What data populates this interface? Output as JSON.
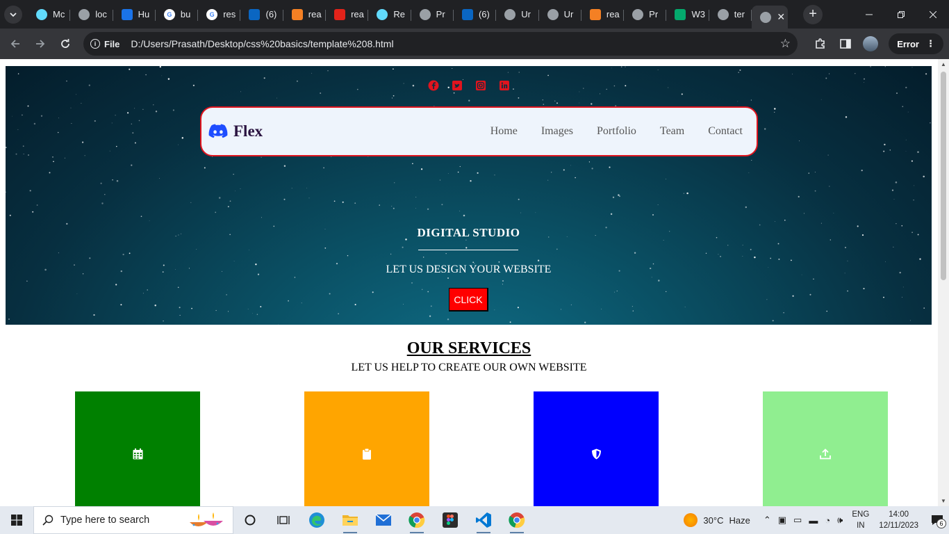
{
  "browser": {
    "tabs": [
      {
        "label": "Mc",
        "icon": "react-icon",
        "color": "#61dafb"
      },
      {
        "label": "loc",
        "icon": "react-icon",
        "color": "#9aa0a6"
      },
      {
        "label": "Hu",
        "icon": "h-logo-icon",
        "color": "#1a73e8"
      },
      {
        "label": "bu",
        "icon": "google-icon",
        "color": "#ffffff"
      },
      {
        "label": "res",
        "icon": "google-icon",
        "color": "#ffffff"
      },
      {
        "label": "(6)",
        "icon": "linkedin-icon",
        "color": "#0a66c2"
      },
      {
        "label": "rea",
        "icon": "stackoverflow-icon",
        "color": "#f48024"
      },
      {
        "label": "rea",
        "icon": "n-logo-icon",
        "color": "#e2231a"
      },
      {
        "label": "Re",
        "icon": "react-icon",
        "color": "#61dafb"
      },
      {
        "label": "Pr",
        "icon": "github-icon",
        "color": "#9aa0a6"
      },
      {
        "label": "(6)",
        "icon": "linkedin-icon",
        "color": "#0a66c2"
      },
      {
        "label": "Ur",
        "icon": "globe-icon",
        "color": "#9aa0a6"
      },
      {
        "label": "Ur",
        "icon": "globe-icon",
        "color": "#9aa0a6"
      },
      {
        "label": "rea",
        "icon": "stackoverflow-icon",
        "color": "#f48024"
      },
      {
        "label": "Pr",
        "icon": "github-icon",
        "color": "#9aa0a6"
      },
      {
        "label": "W3",
        "icon": "w3-icon",
        "color": "#04aa6d"
      },
      {
        "label": "ter",
        "icon": "globe-icon",
        "color": "#9aa0a6"
      }
    ],
    "url_chip": "File",
    "url": "D:/Users/Prasath/Desktop/css%20basics/template%208.html",
    "error_label": "Error"
  },
  "page": {
    "brand": "Flex",
    "nav": [
      "Home",
      "Images",
      "Portfolio",
      "Team",
      "Contact"
    ],
    "hero_title": "DIGITAL STUDIO",
    "hero_subtitle": "LET US DESIGN YOUR WEBSITE",
    "hero_button": "CLICK",
    "services_title": "OUR SERVICES",
    "services_subtitle": "LET US HELP TO CREATE OUR OWN WEBSITE",
    "cards": [
      {
        "icon": "calendar-icon",
        "color": "#008000"
      },
      {
        "icon": "clipboard-icon",
        "color": "#ffa500"
      },
      {
        "icon": "shield-icon",
        "color": "#0000ff"
      },
      {
        "icon": "upload-icon",
        "color": "#90ee90"
      }
    ],
    "accent_color": "#ff0000"
  },
  "taskbar": {
    "search_placeholder": "Type here to search",
    "weather_temp": "30°C",
    "weather_desc": "Haze",
    "lang_top": "ENG",
    "lang_bottom": "IN",
    "time": "14:00",
    "date": "12/11/2023",
    "notification_count": "6"
  }
}
